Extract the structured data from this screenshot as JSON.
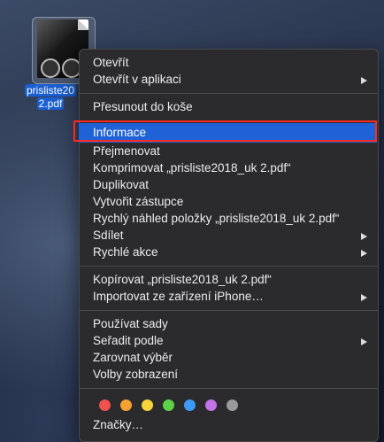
{
  "desktop": {
    "file_name_line1": "prisliste20",
    "file_name_line2": "2.pdf"
  },
  "menu": {
    "groups": [
      [
        "Otevřít",
        "Otevřít v aplikaci"
      ],
      [
        "Přesunout do koše"
      ],
      [
        "Informace",
        "Přejmenovat",
        "Komprimovat „prisliste2018_uk 2.pdf“",
        "Duplikovat",
        "Vytvořit zástupce",
        "Rychlý náhled položky „prisliste2018_uk 2.pdf“",
        "Sdílet",
        "Rychlé akce"
      ],
      [
        "Kopírovat „prisliste2018_uk 2.pdf“",
        "Importovat ze zařízení iPhone…"
      ],
      [
        "Používat sady",
        "Seřadit podle",
        "Zarovnat výběr",
        "Volby zobrazení"
      ],
      [
        "Značky…"
      ]
    ],
    "open": "Otevřít",
    "open_with": "Otevřít v aplikaci",
    "move_to_trash": "Přesunout do koše",
    "get_info": "Informace",
    "rename": "Přejmenovat",
    "compress": "Komprimovat „prisliste2018_uk 2.pdf“",
    "duplicate": "Duplikovat",
    "make_alias": "Vytvořit zástupce",
    "quick_look": "Rychlý náhled položky „prisliste2018_uk 2.pdf“",
    "share": "Sdílet",
    "quick_actions": "Rychlé akce",
    "copy": "Kopírovat „prisliste2018_uk 2.pdf“",
    "import_iphone": "Importovat ze zařízení iPhone…",
    "use_stacks": "Používat sady",
    "sort_by": "Seřadit podle",
    "clean_up_selection": "Zarovnat výběr",
    "view_options": "Volby zobrazení",
    "tags": "Značky…",
    "highlighted_item": "Informace",
    "tag_colors": [
      "#f0524d",
      "#f6a233",
      "#f5d33a",
      "#5fd147",
      "#3d9bf7",
      "#c373e8",
      "#9a9a9c"
    ],
    "submenu_items": [
      "Otevřít v aplikaci",
      "Sdílet",
      "Rychlé akce",
      "Importovat ze zařízení iPhone…",
      "Seřadit podle"
    ]
  }
}
